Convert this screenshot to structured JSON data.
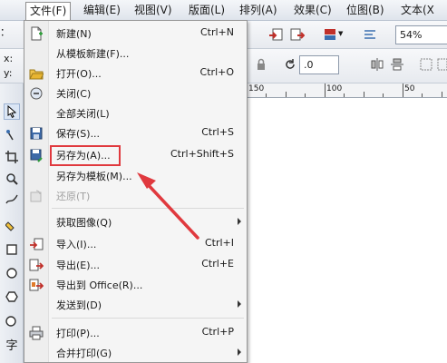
{
  "menubar": {
    "items": [
      "文件(F)",
      "编辑(E)",
      "视图(V)",
      "版面(L)",
      "排列(A)",
      "效果(C)",
      "位图(B)",
      "文本(X"
    ]
  },
  "toolbar": {
    "zoom": "54%"
  },
  "propertybar": {
    "x_label": "x:",
    "y_label": "y:",
    "rotation": ".0"
  },
  "ruler": {
    "labels": [
      "150",
      "100",
      "50"
    ]
  },
  "file_menu": {
    "items": [
      {
        "label": "新建(N)",
        "shortcut": "Ctrl+N",
        "icon": "new-doc-icon"
      },
      {
        "label": "从模板新建(F)...",
        "shortcut": "",
        "icon": ""
      },
      {
        "label": "打开(O)...",
        "shortcut": "Ctrl+O",
        "icon": "open-folder-icon"
      },
      {
        "label": "关闭(C)",
        "shortcut": "",
        "icon": "close-doc-icon"
      },
      {
        "label": "全部关闭(L)",
        "shortcut": "",
        "icon": ""
      },
      {
        "label": "保存(S)...",
        "shortcut": "Ctrl+S",
        "icon": "save-icon"
      },
      {
        "label": "另存为(A)...",
        "shortcut": "Ctrl+Shift+S",
        "icon": "save-as-icon"
      },
      {
        "label": "另存为模板(M)...",
        "shortcut": "",
        "icon": ""
      },
      {
        "label": "还原(T)",
        "shortcut": "",
        "icon": "revert-icon"
      },
      {
        "label": "获取图像(Q)",
        "shortcut": "",
        "icon": ""
      },
      {
        "label": "导入(I)...",
        "shortcut": "Ctrl+I",
        "icon": "import-icon"
      },
      {
        "label": "导出(E)...",
        "shortcut": "Ctrl+E",
        "icon": "export-icon"
      },
      {
        "label": "导出到 Office(R)...",
        "shortcut": "",
        "icon": "export-office-icon"
      },
      {
        "label": "发送到(D)",
        "shortcut": "",
        "icon": ""
      },
      {
        "label": "打印(P)...",
        "shortcut": "Ctrl+P",
        "icon": "print-icon"
      },
      {
        "label": "合并打印(G)",
        "shortcut": "",
        "icon": ""
      }
    ]
  },
  "toolbox": {
    "text_tool": "字"
  },
  "colors": {
    "highlight": "#e0393e",
    "arrow": "#e0393e"
  }
}
